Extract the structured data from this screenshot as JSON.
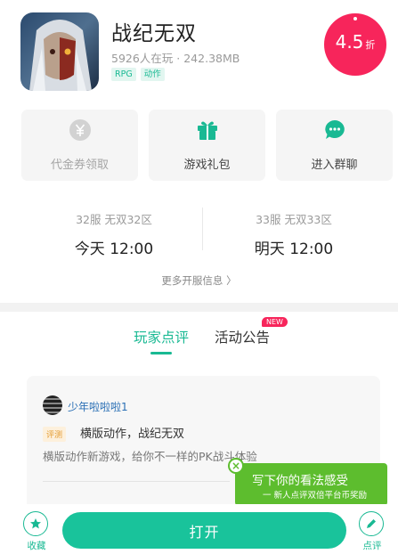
{
  "game": {
    "name": "战纪无双",
    "meta": "5926人在玩 · 242.38MB",
    "tags": [
      "RPG",
      "动作"
    ],
    "discount_value": "4.5",
    "discount_unit": "折"
  },
  "actions": [
    {
      "label": "代金券领取",
      "icon": "yuan-coin-icon",
      "enabled": false
    },
    {
      "label": "游戏礼包",
      "icon": "gift-icon",
      "enabled": true
    },
    {
      "label": "进入群聊",
      "icon": "chat-bubble-icon",
      "enabled": true
    }
  ],
  "servers": [
    {
      "name": "32服 无双32区",
      "time": "今天 12:00"
    },
    {
      "name": "33服 无双33区",
      "time": "明天 12:00"
    }
  ],
  "more_servers": "更多开服信息 〉",
  "tabs": {
    "reviews": "玩家点评",
    "announcements": "活动公告",
    "new_badge": "NEW"
  },
  "review": {
    "reviewer": "少年啦啦啦1",
    "badge": "评测",
    "title": "横版动作，战纪无双",
    "body": "横版动作新游戏，给你不一样的PK战斗体验"
  },
  "tooltip": {
    "title": "写下你的看法感受",
    "subtitle": "一 新人点评双倍平台币奖励",
    "close": "×"
  },
  "bottom": {
    "collect_label": "收藏",
    "open_label": "打开",
    "rate_label": "点评"
  },
  "colors": {
    "accent": "#19b993",
    "discount": "#f7255b",
    "tooltip": "#5dbd2e"
  }
}
